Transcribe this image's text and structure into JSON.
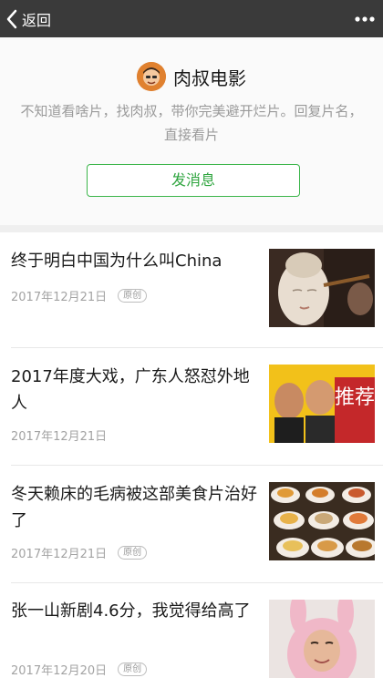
{
  "topbar": {
    "back_label": "返回",
    "more_icon": "more-dots-icon"
  },
  "profile": {
    "name": "肉叔电影",
    "description": "不知道看啥片，找肉叔，带你完美避开烂片。回复片名，直接看片",
    "send_message_label": "发消息"
  },
  "articles": [
    {
      "title": "终于明白中国为什么叫China",
      "date": "2017年12月21日",
      "badge": "原创",
      "thumb": "buddha-statue-image"
    },
    {
      "title": "2017年度大戏，广东人怒怼外地人",
      "date": "2017年12月21日",
      "badge": "",
      "thumb": "recommend-poster-image",
      "thumb_text": "推荐"
    },
    {
      "title": "冬天赖床的毛病被这部美食片治好了",
      "date": "2017年12月21日",
      "badge": "原创",
      "thumb": "dim-sum-plates-image"
    },
    {
      "title": "张一山新剧4.6分，我觉得给高了",
      "date": "2017年12月20日",
      "badge": "原创",
      "thumb": "pink-bunny-costume-image"
    }
  ],
  "colors": {
    "topbar": "#3a3a3a",
    "accent_green": "#2fa53f",
    "text_gray": "#9a9a9a"
  }
}
